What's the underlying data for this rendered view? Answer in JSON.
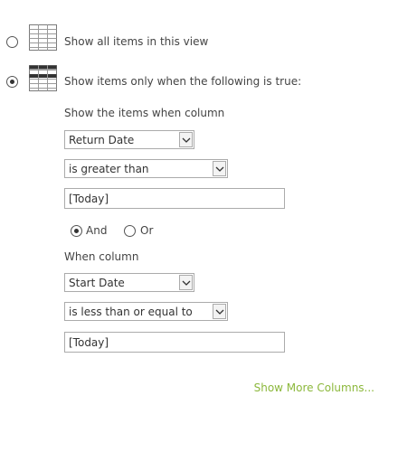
{
  "options": {
    "show_all": {
      "label": "Show all items in this view",
      "selected": false
    },
    "show_filtered": {
      "label": "Show items only when the following is true:",
      "selected": true
    }
  },
  "filter1": {
    "heading": "Show the items when column",
    "column": "Return Date",
    "operator": "is greater than",
    "value": "[Today]"
  },
  "logic": {
    "and_label": "And",
    "or_label": "Or",
    "selected": "And"
  },
  "filter2": {
    "heading": "When column",
    "column": "Start Date",
    "operator": "is less than or equal to",
    "value": "[Today]"
  },
  "more_columns_link": "Show More Columns...",
  "colors": {
    "link": "#8cb83c",
    "text": "#444444",
    "border": "#ababab"
  },
  "icons": {
    "show_all": "table-all-icon",
    "show_filtered": "table-filtered-icon",
    "dropdown": "chevron-down-icon"
  }
}
